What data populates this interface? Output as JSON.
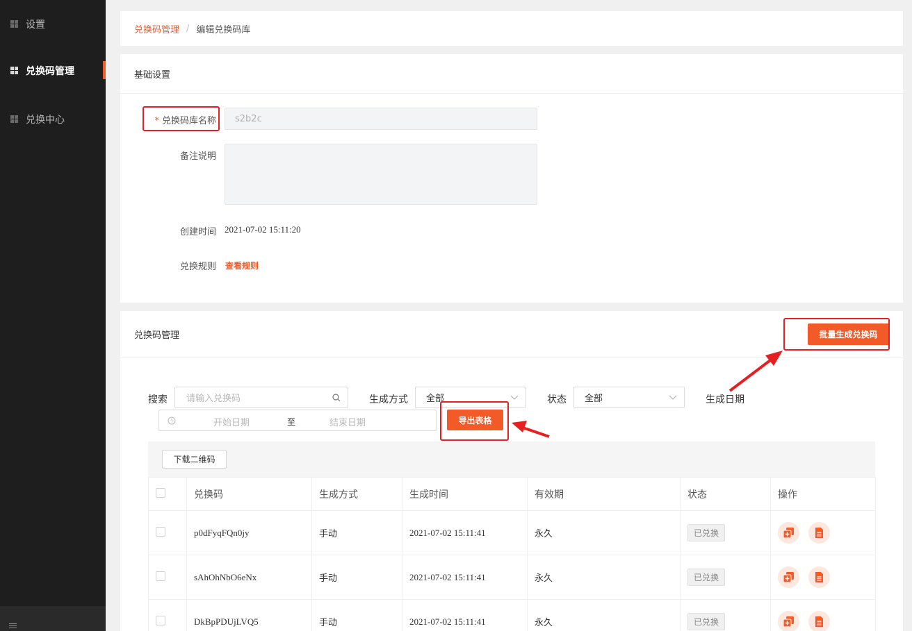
{
  "sidebar": {
    "items": [
      {
        "label": "设置"
      },
      {
        "label": "兑换码管理"
      },
      {
        "label": "兑换中心"
      }
    ]
  },
  "breadcrumb": {
    "parent": "兑换码管理",
    "separator": "/",
    "current": "编辑兑换码库"
  },
  "basic": {
    "title": "基础设置",
    "name_label": "兑换码库名称",
    "required_mark": "*",
    "name_value": "s2b2c",
    "note_label": "备注说明",
    "note_value": "",
    "created_label": "创建时间",
    "created_value": "2021-07-02 15:11:20",
    "rule_label": "兑换规则",
    "rule_link": "查看规则"
  },
  "manage": {
    "title": "兑换码管理",
    "batch_button": "批量生成兑换码",
    "search_label": "搜索",
    "search_placeholder": "请输入兑换码",
    "method_label": "生成方式",
    "method_value": "全部",
    "status_label": "状态",
    "status_value": "全部",
    "date_label": "生成日期",
    "date_start_placeholder": "开始日期",
    "date_separator": "至",
    "date_end_placeholder": "结束日期",
    "export_button": "导出表格",
    "download_qr_button": "下载二维码"
  },
  "table": {
    "headers": [
      "兑换码",
      "生成方式",
      "生成时间",
      "有效期",
      "状态",
      "操作"
    ],
    "rows": [
      {
        "code": "p0dFyqFQn0jy",
        "method": "手动",
        "time": "2021-07-02 15:11:41",
        "validity": "永久",
        "status": "已兑换"
      },
      {
        "code": "sAhOhNbO6eNx",
        "method": "手动",
        "time": "2021-07-02 15:11:41",
        "validity": "永久",
        "status": "已兑换"
      },
      {
        "code": "DkBpPDUjLVQ5",
        "method": "手动",
        "time": "2021-07-02 15:11:41",
        "validity": "永久",
        "status": "已兑换"
      }
    ]
  },
  "colors": {
    "accent": "#f25a27",
    "sidebar_bg": "#1e1e1e",
    "annotation": "#e62020"
  }
}
